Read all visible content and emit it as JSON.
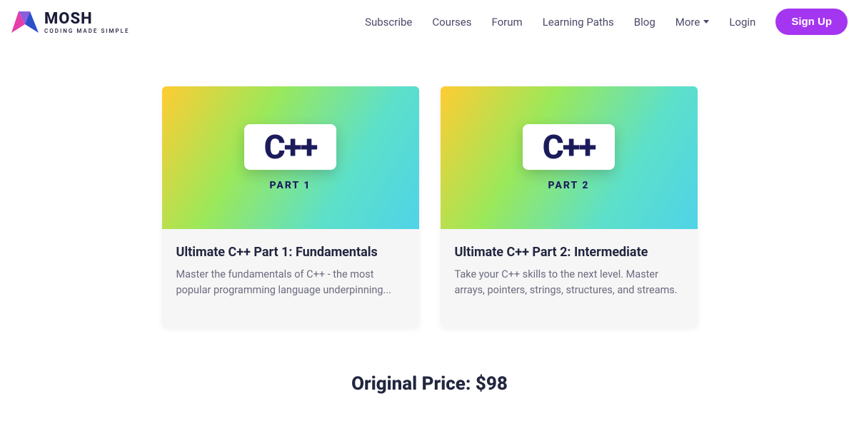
{
  "brand": {
    "name": "MOSH",
    "tagline": "CODING MADE SIMPLE"
  },
  "nav": {
    "subscribe": "Subscribe",
    "courses": "Courses",
    "forum": "Forum",
    "learning_paths": "Learning Paths",
    "blog": "Blog",
    "more": "More",
    "login": "Login",
    "signup": "Sign Up"
  },
  "courses": [
    {
      "badge": "C++",
      "part": "PART 1",
      "title": "Ultimate C++ Part 1: Fundamentals",
      "desc": "Master the fundamentals of C++ - the most popular programming language underpinning..."
    },
    {
      "badge": "C++",
      "part": "PART 2",
      "title": "Ultimate C++ Part 2: Intermediate",
      "desc": "Take your C++ skills to the next level. Master arrays, pointers, strings, structures, and streams."
    }
  ],
  "pricing": {
    "original": "Original Price: $98"
  }
}
